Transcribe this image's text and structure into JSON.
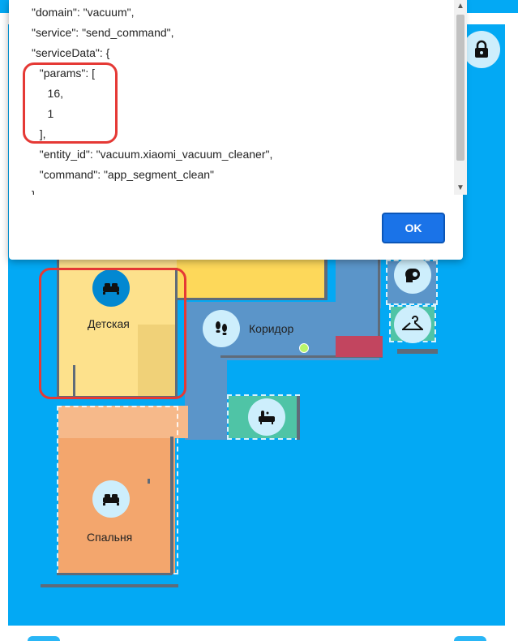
{
  "dialog": {
    "code_lines": [
      "\"domain\": \"vacuum\",",
      "\"service\": \"send_command\",",
      "\"serviceData\": {",
      "  \"params\": [",
      "    16,",
      "    1",
      "  ],",
      "  \"entity_id\": \"vacuum.xiaomi_vacuum_cleaner\",",
      "  \"command\": \"app_segment_clean\"",
      "}"
    ],
    "ok_label": "OK"
  },
  "map": {
    "rooms": [
      {
        "label": "Детская",
        "icon": "bed-icon"
      },
      {
        "label": "Коридор",
        "icon": "footprints-icon"
      },
      {
        "label": "Спальня",
        "icon": "bed-icon"
      },
      {
        "label": "",
        "icon": "bathtub-icon"
      },
      {
        "label": "",
        "icon": "toilet-paper-icon"
      },
      {
        "label": "",
        "icon": "hanger-icon"
      }
    ],
    "lock_icon": "lock-icon"
  },
  "colors": {
    "background": "#03a9f4",
    "kids_room": "#fde18c",
    "top_room": "#fdd85a",
    "corridor": "#5b95c9",
    "bathroom": "#4fc4a6",
    "bedroom": "#f3a66d",
    "highlight": "#e53935",
    "ok_button": "#1a73e8"
  }
}
